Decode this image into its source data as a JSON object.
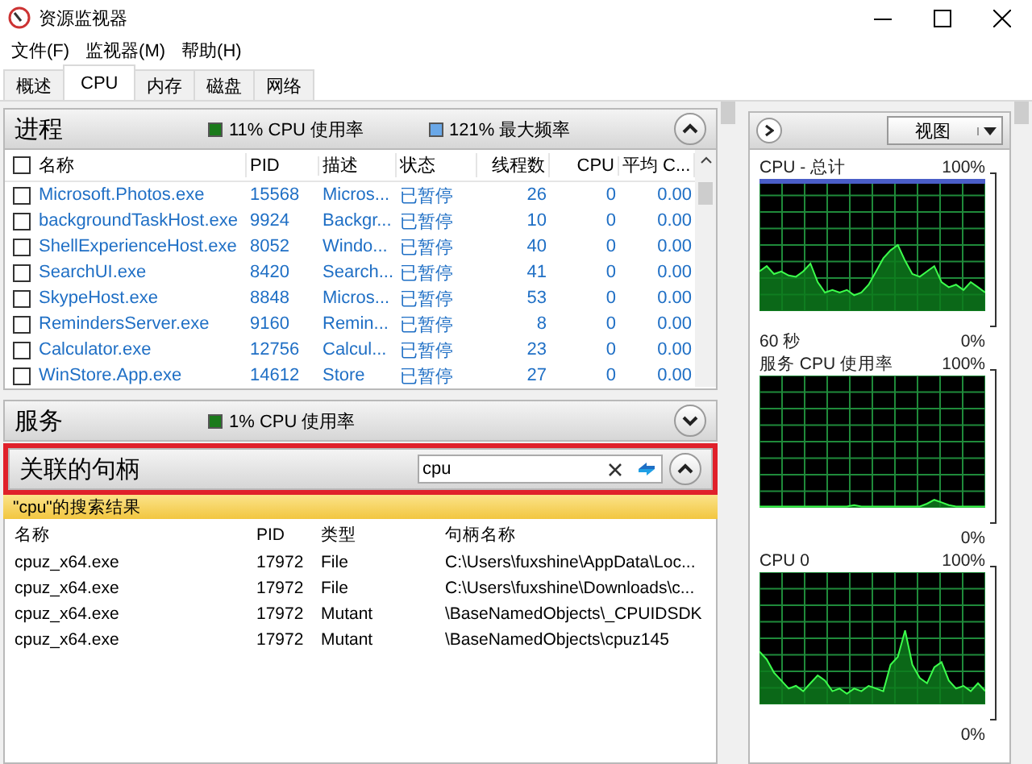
{
  "window": {
    "title": "资源监视器"
  },
  "menu": [
    "文件(F)",
    "监视器(M)",
    "帮助(H)"
  ],
  "tabs": [
    {
      "label": "概述",
      "selected": false
    },
    {
      "label": "CPU",
      "selected": true
    },
    {
      "label": "内存",
      "selected": false
    },
    {
      "label": "磁盘",
      "selected": false
    },
    {
      "label": "网络",
      "selected": false
    }
  ],
  "processes": {
    "title": "进程",
    "expanded": true,
    "legend": [
      {
        "text": "11% CPU 使用率",
        "color": "#1a7a1a"
      },
      {
        "text": "121% 最大频率",
        "color": "#6aa8e8"
      }
    ],
    "all_checked": false,
    "columns": [
      "名称",
      "PID",
      "描述",
      "状态",
      "线程数",
      "CPU",
      "平均 C..."
    ],
    "rows": [
      {
        "checked": false,
        "cells": [
          "Microsoft.Photos.exe",
          "15568",
          "Micros...",
          "已暂停",
          "26",
          "0",
          "0.00"
        ]
      },
      {
        "checked": false,
        "cells": [
          "backgroundTaskHost.exe",
          "9924",
          "Backgr...",
          "已暂停",
          "10",
          "0",
          "0.00"
        ]
      },
      {
        "checked": false,
        "cells": [
          "ShellExperienceHost.exe",
          "8052",
          "Windo...",
          "已暂停",
          "40",
          "0",
          "0.00"
        ]
      },
      {
        "checked": false,
        "cells": [
          "SearchUI.exe",
          "8420",
          "Search...",
          "已暂停",
          "41",
          "0",
          "0.00"
        ]
      },
      {
        "checked": false,
        "cells": [
          "SkypeHost.exe",
          "8848",
          "Micros...",
          "已暂停",
          "53",
          "0",
          "0.00"
        ]
      },
      {
        "checked": false,
        "cells": [
          "RemindersServer.exe",
          "9160",
          "Remin...",
          "已暂停",
          "8",
          "0",
          "0.00"
        ]
      },
      {
        "checked": false,
        "cells": [
          "Calculator.exe",
          "12756",
          "Calcul...",
          "已暂停",
          "23",
          "0",
          "0.00"
        ]
      },
      {
        "checked": false,
        "cells": [
          "WinStore.App.exe",
          "14612",
          "Store",
          "已暂停",
          "27",
          "0",
          "0.00"
        ]
      }
    ]
  },
  "services": {
    "title": "服务",
    "expanded": false,
    "legend": [
      {
        "text": "1% CPU 使用率",
        "color": "#1a7a1a"
      }
    ]
  },
  "handles": {
    "title": "关联的句柄",
    "expanded": true,
    "highlighted": true,
    "search": {
      "value": "cpu"
    },
    "banner": "\"cpu\"的搜索结果",
    "columns": [
      "名称",
      "PID",
      "类型",
      "句柄名称"
    ],
    "rows": [
      [
        "cpuz_x64.exe",
        "17972",
        "File",
        "C:\\Users\\fuxshine\\AppData\\Loc..."
      ],
      [
        "cpuz_x64.exe",
        "17972",
        "File",
        "C:\\Users\\fuxshine\\Downloads\\c..."
      ],
      [
        "cpuz_x64.exe",
        "17972",
        "Mutant",
        "\\BaseNamedObjects\\_CPUIDSDK"
      ],
      [
        "cpuz_x64.exe",
        "17972",
        "Mutant",
        "\\BaseNamedObjects\\cpuz145"
      ]
    ]
  },
  "graphs_panel": {
    "view_button": "视图",
    "graphs": [
      {
        "title": "CPU - 总计",
        "max": "100%",
        "time": "60 秒",
        "min": "0%"
      },
      {
        "title": "服务 CPU 使用率",
        "max": "100%",
        "min": "0%"
      },
      {
        "title": "CPU 0",
        "max": "100%",
        "min": "0%"
      }
    ]
  }
}
